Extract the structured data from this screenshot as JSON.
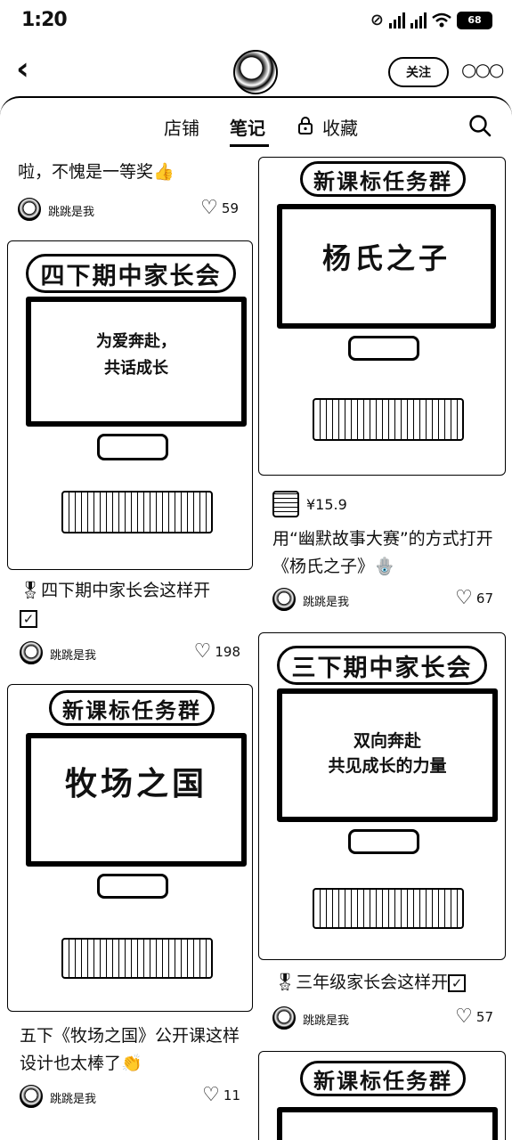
{
  "status": {
    "time": "1:20",
    "battery": "68"
  },
  "nav": {
    "follow_label": "关注",
    "more_label": "○○○"
  },
  "tabs": [
    {
      "label": "店铺"
    },
    {
      "label": "笔记"
    },
    {
      "label": "收藏"
    }
  ],
  "notes": {
    "card1": {
      "title": "啦，不愧是一等奖",
      "emoji": "👍",
      "author": "跳跳是我",
      "likes": "59"
    },
    "card2": {
      "banner": "新课标任务群",
      "screen_title": "杨氏之子",
      "price": "¥15.9",
      "title": "用“幽默故事大赛”的方式打开《杨氏之子》",
      "emoji": "🪬",
      "author": "跳跳是我",
      "likes": "67"
    },
    "card3": {
      "banner": "四下期中家长会",
      "screen_line1": "为爱奔赴，",
      "screen_line2": "共话成长",
      "title": "四下期中家长会这样开",
      "author": "跳跳是我",
      "likes": "198"
    },
    "card4": {
      "banner": "三下期中家长会",
      "screen_line1": "双向奔赴",
      "screen_line2": "共见成长的力量",
      "title": "三年级家长会这样开",
      "author": "跳跳是我",
      "likes": "57"
    },
    "card5": {
      "banner": "新课标任务群",
      "screen_title": "牧场之国",
      "title": "五下《牧场之国》公开课这样设计也太棒了",
      "emoji": "👏",
      "author": "跳跳是我",
      "likes": "11"
    },
    "card6": {
      "banner": "新课标任务群"
    }
  }
}
